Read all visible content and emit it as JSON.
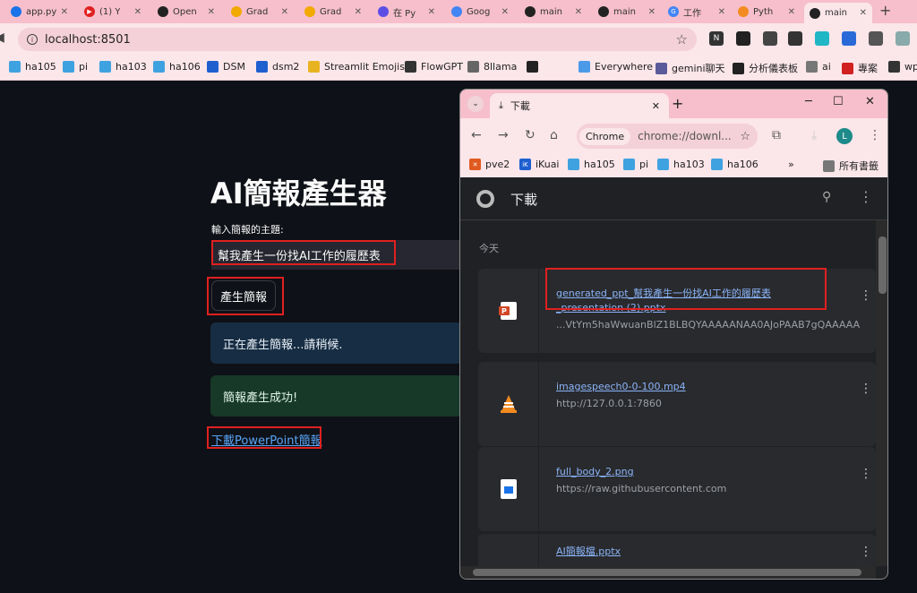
{
  "browser": {
    "tabs": [
      {
        "title": "app.py",
        "color": "#1a73e8"
      },
      {
        "title": "(1) Y",
        "color": "#e02020"
      },
      {
        "title": "Open",
        "color": "#222222"
      },
      {
        "title": "Grad",
        "color": "#f2a900"
      },
      {
        "title": "Grad",
        "color": "#f2a900"
      },
      {
        "title": "在 Py",
        "color": "#5c4ee5"
      },
      {
        "title": "Goog",
        "color": "#4285f4"
      },
      {
        "title": "main",
        "color": "#222222"
      },
      {
        "title": "main",
        "color": "#222222"
      },
      {
        "title": "工作",
        "color": "#4285f4"
      },
      {
        "title": "Pyth",
        "color": "#f28b20"
      },
      {
        "title": "main",
        "color": "#222222"
      }
    ],
    "new_tab": "+",
    "url": "localhost:8501",
    "bookmarks": [
      "ha105",
      "pi",
      "ha103",
      "ha106",
      "DSM",
      "dsm2",
      "Streamlit Emojis",
      "FlowGPT",
      "8llama",
      "",
      "Everywhere",
      "gemini聊天",
      "分析儀表板",
      "ai",
      "專案",
      "wp"
    ]
  },
  "app": {
    "title": "AI簡報產生器",
    "input_label": "輸入簡報的主題:",
    "input_value": "幫我產生一份找AI工作的履歷表",
    "generate_button": "產生簡報",
    "info_message": "正在產生簡報...請稍候.",
    "success_message": "簡報產生成功!",
    "download_link": "下載PowerPoint簡報"
  },
  "downloads_window": {
    "tab_title": "下載",
    "chip": "Chrome",
    "url": "chrome://downl...",
    "avatar": "L",
    "bookmarks": [
      "pve2",
      "iKuai",
      "ha105",
      "pi",
      "ha103",
      "ha106"
    ],
    "more_bookmarks": "»",
    "all_bookmarks": "所有書籤",
    "header_title": "下載",
    "section": "今天",
    "items": [
      {
        "name": "generated_ppt_幫我產生一份找AI工作的履歷表_presentation (2).pptx",
        "sub": "...VtYm5haWwuanBlZ1BLBQYAAAAANAA0AJoPAAB7gQAAAAA"
      },
      {
        "name": "imagespeech0-0-100.mp4",
        "sub": "http://127.0.0.1:7860"
      },
      {
        "name": "full_body_2.png",
        "sub": "https://raw.githubusercontent.com"
      },
      {
        "name": "AI簡報檔.pptx",
        "sub": ""
      }
    ]
  }
}
